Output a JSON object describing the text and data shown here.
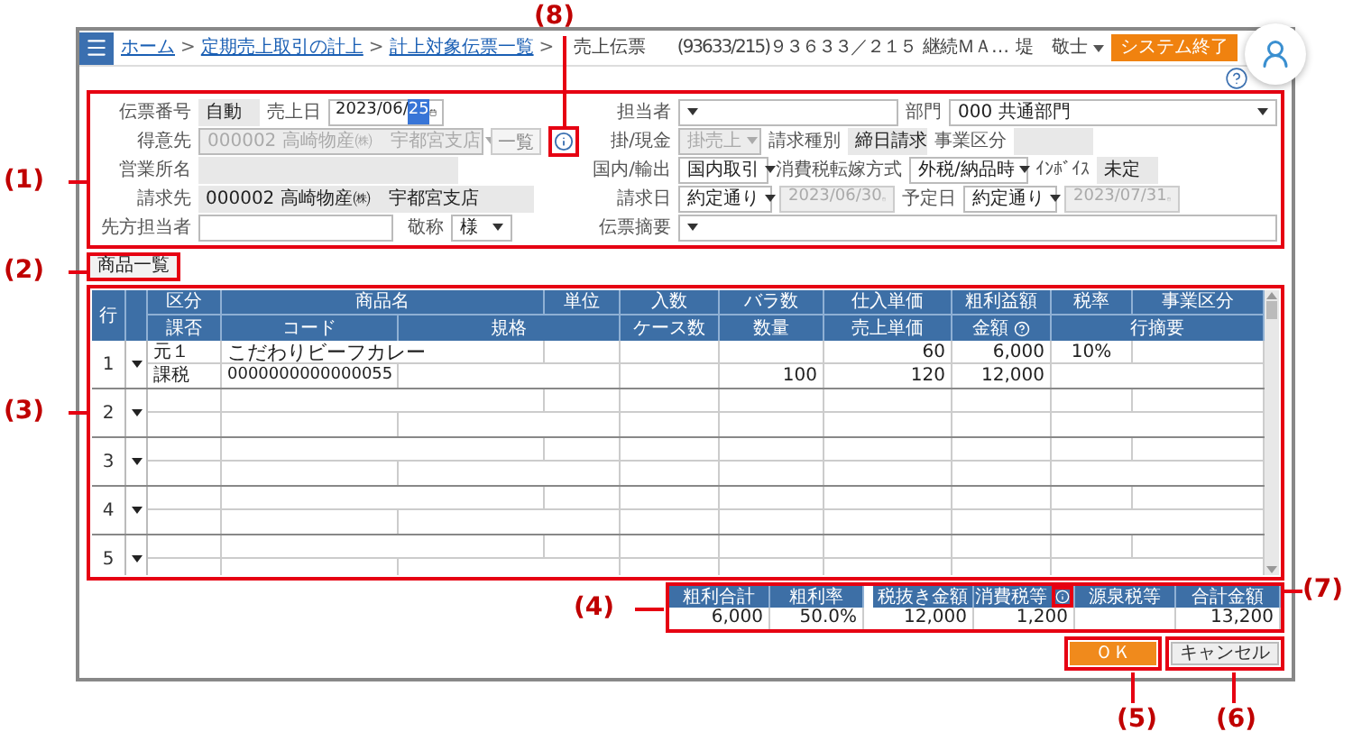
{
  "header": {
    "breadcrumbs": [
      {
        "label": "ホーム",
        "link": true,
        "separator": ">"
      },
      {
        "label": "定期売上取引の計上",
        "link": true,
        "separator": ">"
      },
      {
        "label": "計上対象伝票一覧",
        "link": true,
        "separator": ">"
      },
      {
        "label": "売上伝票",
        "link": false
      }
    ],
    "account_code": "(93633/215)９３６３３／２１５",
    "company": "継続ＭＡ…",
    "user": "堤　敬士",
    "exit_button": "システム終了"
  },
  "slip_form": {
    "slip_number": {
      "label": "伝票番号",
      "value": "自動"
    },
    "sales_date": {
      "label": "売上日",
      "value": "2023/06/",
      "selected_part": "25"
    },
    "customer": {
      "label": "得意先",
      "value": "000002 高崎物産㈱　宇都宮支店",
      "disabled": true,
      "list_button": "一覧"
    },
    "sales_office": {
      "label": "営業所名"
    },
    "billing_to": {
      "label": "請求先",
      "value": "000002 高崎物産㈱　宇都宮支店"
    },
    "contact": {
      "label": "先方担当者"
    },
    "honorific": {
      "label": "敬称",
      "value": "様"
    },
    "staff": {
      "label": "担当者"
    },
    "department": {
      "label": "部門",
      "value": "000 共通部門"
    },
    "payment": {
      "label": "掛/現金",
      "value": "掛売上",
      "disabled": true
    },
    "billing_type": {
      "label": "請求種別",
      "value": "締日請求"
    },
    "business_type": {
      "label": "事業区分"
    },
    "trade": {
      "label": "国内/輸出",
      "value": "国内取引"
    },
    "tax_method": {
      "label": "消費税転嫁方式",
      "value": "外税/納品時"
    },
    "invoice": {
      "label": "ｲﾝﾎﾞｲｽ",
      "value": "未定"
    },
    "billing_date": {
      "label": "請求日",
      "value": "約定通り",
      "date": "2023/06/30",
      "date_disabled": true
    },
    "due_date": {
      "label": "予定日",
      "value": "約定通り",
      "date": "2023/07/31",
      "date_disabled": true
    },
    "memo": {
      "label": "伝票摘要"
    }
  },
  "product_list_button": "商品一覧",
  "table": {
    "row_header": "行",
    "header_1": [
      {
        "label": "区分"
      },
      {
        "label": "商品名"
      },
      {
        "label": "単位"
      },
      {
        "label": "入数"
      },
      {
        "label": "バラ数"
      },
      {
        "label": "仕入単価"
      },
      {
        "label": "粗利益額"
      },
      {
        "label": "税率"
      },
      {
        "label": "事業区分"
      }
    ],
    "header_2": [
      {
        "label": "課否"
      },
      {
        "label": "コード"
      },
      {
        "label": "規格"
      },
      {
        "label": "ケース数"
      },
      {
        "label": "数量"
      },
      {
        "label": "売上単価"
      },
      {
        "label": "金額",
        "help": true
      },
      {
        "label": "行摘要"
      }
    ],
    "rows": [
      {
        "number": "1",
        "line_1": {
          "category": "元１",
          "product_name": "こだわりビーフカレー",
          "cost_price": "60",
          "gross_profit": "6,000",
          "tax_rate": "10%"
        },
        "line_2": {
          "tax_class": "課税",
          "code": "0000000000000055",
          "quantity": "100",
          "unit_price": "120",
          "amount": "12,000"
        }
      },
      {
        "number": "2"
      },
      {
        "number": "3"
      },
      {
        "number": "4"
      },
      {
        "number": "5"
      }
    ]
  },
  "totals": [
    {
      "label": "粗利合計",
      "value": "6,000"
    },
    {
      "label": "粗利率",
      "value": "50.0%"
    },
    {
      "label": "税抜き金額",
      "value": "12,000"
    },
    {
      "label": "消費税等",
      "value": "1,200",
      "info": true
    },
    {
      "label": "源泉税等"
    },
    {
      "label": "合計金額",
      "value": "13,200"
    }
  ],
  "ok_button": "ＯＫ",
  "cancel_button": "キャンセル",
  "callouts": [
    {
      "label": "(1)"
    },
    {
      "label": "(2)"
    },
    {
      "label": "(3)"
    },
    {
      "label": "(4)"
    },
    {
      "label": "(5)"
    },
    {
      "label": "(6)"
    },
    {
      "label": "(7)"
    },
    {
      "label": "(8)"
    }
  ]
}
